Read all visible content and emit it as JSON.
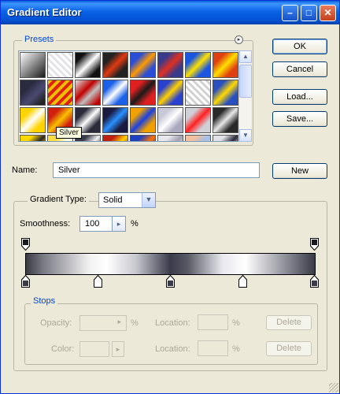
{
  "window": {
    "title": "Gradient Editor"
  },
  "titlebar_buttons": {
    "minimize": "–",
    "maximize": "□",
    "close": "✕"
  },
  "presets": {
    "legend": "Presets",
    "menu_icon": "▸",
    "tooltip": "Silver",
    "scroll_up": "▲",
    "scroll_down": "▼",
    "swatches": [
      "linear-gradient(135deg,#ffffff,#1a1a1a)",
      "repeating-linear-gradient(45deg,#ffffff 0 3px,#e2e2e8 3px 6px)",
      "linear-gradient(135deg,#111 20%,#fff 50%,#111 80%)",
      "linear-gradient(135deg,#222 25%,#e03a12 50%,#222 75%)",
      "linear-gradient(135deg,#2a4ed6 25%,#ff9a00 50%,#2a4ed6 75%)",
      "linear-gradient(135deg,#3a3a8a 25%,#e03020 50%,#3a3a8a 75%)",
      "linear-gradient(135deg,#1a56e0 25%,#ffe000 50%,#1a56e0 75%)",
      "linear-gradient(135deg,#e04010 25%,#ffe000 50%,#e04010 75%)",
      "linear-gradient(135deg,#2a2a40 30%,#4a4a70 60%,#222 90%)",
      "repeating-linear-gradient(135deg,#f0c000 0 4px,#e02010 4px 8px)",
      "linear-gradient(135deg,#e0e0e0,#c00000 40%,#c0c0c0 60%,#c00000 90%)",
      "linear-gradient(135deg,#1a60e8 25%,#ffffff 50%,#1a60e8 75%)",
      "linear-gradient(135deg,#e02020 25%,#1a1a1a 50%,#e02020 75%)",
      "linear-gradient(135deg,#2a40d0 25%,#ffd000 50%,#2a40d0 75%)",
      "repeating-linear-gradient(45deg,#ffffff 0 3px,#d0d0d0 3px 6px)",
      "linear-gradient(135deg,#2a50c0 25%,#ffd800 50%,#2a50c0 75%)",
      "linear-gradient(135deg,#ffd400 25%,#ffffff 50%,#ffd400 75%)",
      "linear-gradient(135deg,#d02010 25%,#f8c000 50%,#d02010 75%)",
      "linear-gradient(135deg,#2a2a3a 25%,#ffffff 50%,#2a2a3a 75%)",
      "linear-gradient(135deg,#1a1a40 25%,#2a90ff 50%,#1a1a40 75%)",
      "linear-gradient(135deg,#f0a000 25%,#1a40e0 50%,#f0a000 75%)",
      "linear-gradient(135deg,#c8c8d8 25%,#ffffff 50%,#a8a8c0 75%)",
      "linear-gradient(135deg,#d0d0d8 25%,#ff2020 50%,#d0d0d8 75%)",
      "linear-gradient(135deg,#2a2a2a 25%,#e8e8e8 50%,#2a2a2a 75%)",
      "linear-gradient(135deg,#ffd800 25%,#2a2a2a 50%,#ffd800 75%)",
      "linear-gradient(135deg,#ffe040 25%,#ffffff 50%,#ffe040 75%)",
      "linear-gradient(135deg,#3a3a4a 25%,#f0f0f0 50%,#3a3a4a 75%)",
      "linear-gradient(135deg,#c02010 25%,#ffd000 50%,#c02010 75%)",
      "linear-gradient(135deg,#2040c0 25%,#ff7000 50%,#2040c0 75%)",
      "linear-gradient(135deg,#e8e8ee 25%,#a0a0b0 50%,#e8e8ee 75%)",
      "linear-gradient(135deg,#f0c0a0 25%,#a0c0f0 50%,#f0c0a0 75%)",
      "linear-gradient(135deg,#e0e0e8 25%,#2a2a3a 50%,#e0e0e8 75%)",
      "repeating-linear-gradient(45deg,#ffd800 0 4px,#ffffff 4px 8px)",
      "linear-gradient(135deg,#d03010 25%,#f0c000 50%,#d03010 75%)",
      "linear-gradient(135deg,#ffffff 25%,#222 50%,#ffffff 75%)",
      "linear-gradient(135deg,#3a3a4a 25%,#ffffff 50%,#3a3a4a 75%)",
      "linear-gradient(135deg,#e04010 25%,#3050e0 50%,#e04010 75%)",
      "linear-gradient(135deg,#202040 25%,#8090e0 50%,#202040 75%)",
      "linear-gradient(135deg,#c0c0d0 25%,#ffffff 50%,#c0c0d0 75%)",
      "linear-gradient(135deg,#e03010 25%,#ffd000 50%,#e03010 75%)"
    ]
  },
  "buttons": {
    "ok": "OK",
    "cancel": "Cancel",
    "load": "Load...",
    "save": "Save...",
    "new": "New"
  },
  "name_field": {
    "label": "Name:",
    "value": "Silver"
  },
  "gradient": {
    "type_label": "Gradient Type:",
    "type_value": "Solid",
    "dropdown_arrow": "▼",
    "smoothness_label": "Smoothness:",
    "smoothness_value": "100",
    "smoothness_arrow": "▸",
    "smoothness_unit": "%"
  },
  "stops": {
    "legend": "Stops",
    "opacity_label": "Opacity:",
    "opacity_arrow": "▸",
    "opacity_unit": "%",
    "location_label": "Location:",
    "location_unit": "%",
    "color_label": "Color:",
    "color_arrow": "▸",
    "delete_label": "Delete"
  }
}
